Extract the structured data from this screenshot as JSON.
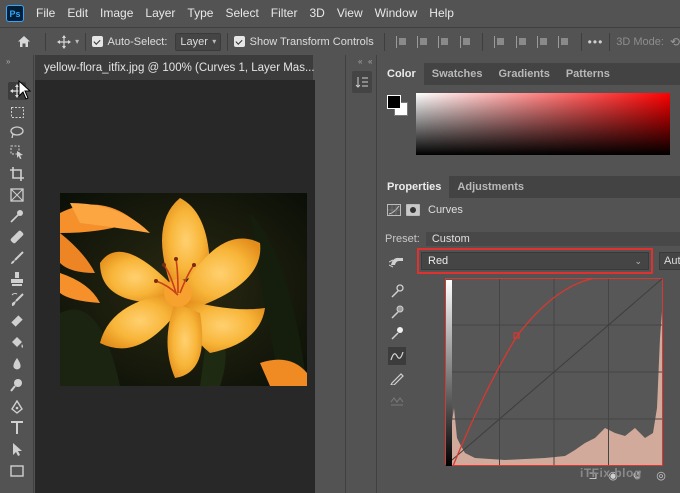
{
  "menubar": {
    "logo": "Ps",
    "items": [
      "File",
      "Edit",
      "Image",
      "Layer",
      "Type",
      "Select",
      "Filter",
      "3D",
      "View",
      "Window",
      "Help"
    ]
  },
  "options": {
    "auto_select_label": "Auto-Select:",
    "auto_select_value": "Layer",
    "transform_label": "Show Transform Controls",
    "mode_label": "3D Mode:"
  },
  "document": {
    "tab_title": "yellow-flora_itfix.jpg @ 100% (Curves 1, Layer Mas...",
    "close": "×"
  },
  "color_panel": {
    "tabs": [
      "Color",
      "Swatches",
      "Gradients",
      "Patterns"
    ]
  },
  "properties_panel": {
    "tabs": [
      "Properties",
      "Adjustments"
    ],
    "adjustment_name": "Curves",
    "preset_label": "Preset:",
    "preset_value": "Custom",
    "channel_value": "Red",
    "auto_label": "Auto"
  },
  "watermark": "iTFix blog",
  "colors": {
    "accent": "#e0312f",
    "panel_bg": "#535353",
    "canvas_bg": "#282828",
    "curve": "#d8382f"
  }
}
